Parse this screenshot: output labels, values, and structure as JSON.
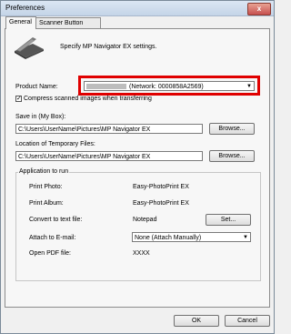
{
  "window": {
    "title": "Preferences",
    "close_glyph": "x"
  },
  "tabs": [
    {
      "label": "General",
      "active": true
    },
    {
      "label": "Scanner Button Settings",
      "active": false
    }
  ],
  "intro": {
    "text": "Specify MP Navigator EX settings.",
    "icon": "scanner-icon"
  },
  "product": {
    "label": "Product Name:",
    "value": "(Network: 0000858A2569)",
    "compress_label": "Compress scanned images when transferring",
    "compress_checked": true
  },
  "save_in": {
    "label": "Save in (My Box):",
    "value": "C:\\Users\\UserName\\Pictures\\MP Navigator EX",
    "browse": "Browse..."
  },
  "temp": {
    "label": "Location of Temporary Files:",
    "value": "C:\\Users\\UserName\\Pictures\\MP Navigator EX",
    "browse": "Browse..."
  },
  "apps": {
    "legend": "Application to run",
    "print_photo_label": "Print Photo:",
    "print_photo_value": "Easy-PhotoPrint EX",
    "print_album_label": "Print Album:",
    "print_album_value": "Easy-PhotoPrint EX",
    "convert_label": "Convert to text file:",
    "convert_value": "Notepad",
    "set_button": "Set...",
    "attach_label": "Attach to E-mail:",
    "attach_value": "None (Attach Manually)",
    "pdf_label": "Open PDF file:",
    "pdf_value": "XXXX"
  },
  "footer": {
    "ok": "OK",
    "cancel": "Cancel"
  },
  "colors": {
    "highlight": "#e00000"
  }
}
